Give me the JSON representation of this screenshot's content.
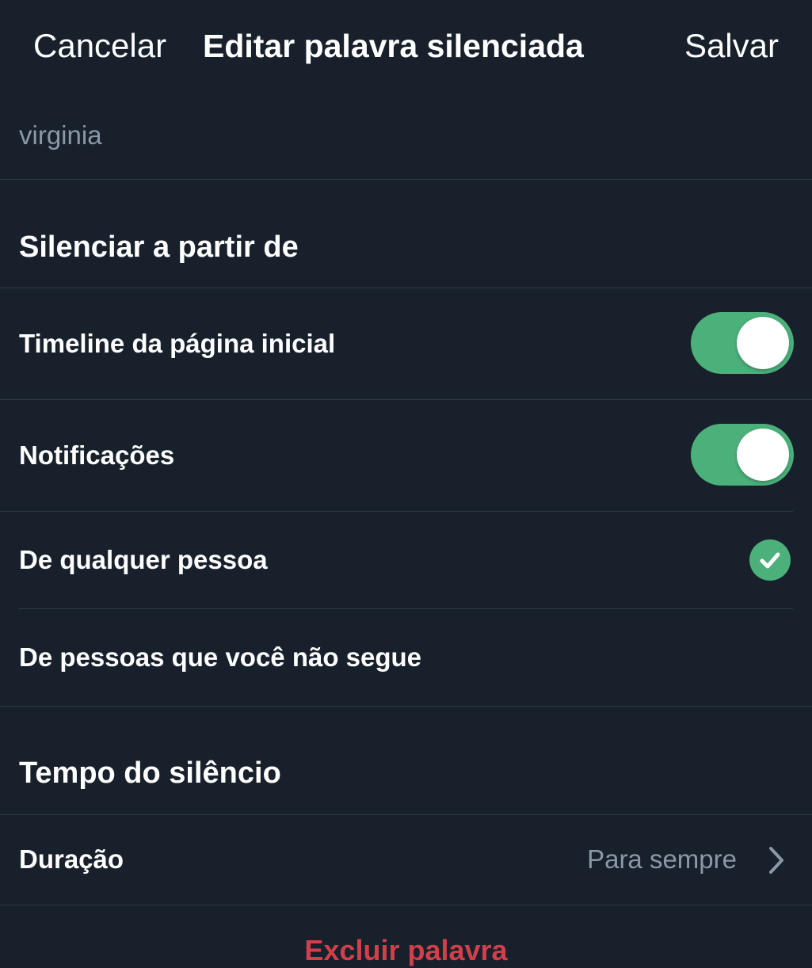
{
  "header": {
    "cancel_label": "Cancelar",
    "title": "Editar palavra silenciada",
    "save_label": "Salvar"
  },
  "word": {
    "value": "virginia"
  },
  "mute_from": {
    "heading": "Silenciar a partir de",
    "home_timeline": {
      "label": "Timeline da página inicial",
      "enabled": true
    },
    "notifications": {
      "label": "Notificações",
      "enabled": true
    },
    "options": [
      {
        "label": "De qualquer pessoa",
        "selected": true
      },
      {
        "label": "De pessoas que você não segue",
        "selected": false
      }
    ]
  },
  "mute_duration": {
    "heading": "Tempo do silêncio",
    "duration_label": "Duração",
    "duration_value": "Para sempre"
  },
  "delete_label": "Excluir palavra",
  "colors": {
    "background": "#17202b",
    "divider": "#2f3a47",
    "accent_green": "#4cb07b",
    "secondary_text": "#8b98a5",
    "danger_red": "#d1404a"
  },
  "icons": {
    "check": "check-icon",
    "chevron": "chevron-right-icon"
  }
}
